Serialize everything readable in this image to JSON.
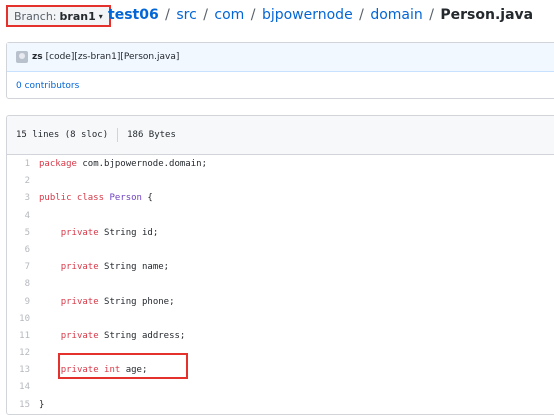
{
  "header": {
    "branch_label": "Branch:",
    "branch_value": "bran1",
    "caret": "▾",
    "crumbs": [
      {
        "text": "test06"
      },
      {
        "text": "src"
      },
      {
        "text": "com"
      },
      {
        "text": "bjpowernode"
      },
      {
        "text": "domain"
      }
    ],
    "separator": "/",
    "file_name": "Person.java"
  },
  "commit": {
    "author": "zs",
    "message": "[code][zs-bran1][Person.java]",
    "contributors": "0 contributors"
  },
  "file": {
    "lines_info": "15 lines (8 sloc)",
    "size": "186 Bytes",
    "code_lines": [
      {
        "n": "1",
        "parts": [
          [
            "kw",
            "package "
          ],
          [
            "plain",
            "com.bjpowernode.domain;"
          ]
        ]
      },
      {
        "n": "2",
        "parts": []
      },
      {
        "n": "3",
        "parts": [
          [
            "kw",
            "public class "
          ],
          [
            "cls",
            "Person"
          ],
          [
            "plain",
            " {"
          ]
        ]
      },
      {
        "n": "4",
        "parts": []
      },
      {
        "n": "5",
        "parts": [
          [
            "plain",
            "    "
          ],
          [
            "kw",
            "private "
          ],
          [
            "plain",
            "String id;"
          ]
        ]
      },
      {
        "n": "6",
        "parts": []
      },
      {
        "n": "7",
        "parts": [
          [
            "plain",
            "    "
          ],
          [
            "kw",
            "private "
          ],
          [
            "plain",
            "String name;"
          ]
        ]
      },
      {
        "n": "8",
        "parts": []
      },
      {
        "n": "9",
        "parts": [
          [
            "plain",
            "    "
          ],
          [
            "kw",
            "private "
          ],
          [
            "plain",
            "String phone;"
          ]
        ]
      },
      {
        "n": "10",
        "parts": []
      },
      {
        "n": "11",
        "parts": [
          [
            "plain",
            "    "
          ],
          [
            "kw",
            "private "
          ],
          [
            "plain",
            "String address;"
          ]
        ]
      },
      {
        "n": "12",
        "parts": []
      },
      {
        "n": "13",
        "parts": [
          [
            "plain",
            "    "
          ],
          [
            "kw",
            "private int "
          ],
          [
            "plain",
            "age;"
          ]
        ]
      },
      {
        "n": "14",
        "parts": []
      },
      {
        "n": "15",
        "parts": [
          [
            "plain",
            "}"
          ]
        ]
      }
    ]
  },
  "colors": {
    "annotation_red": "#e5312c",
    "link_blue": "#0366d6",
    "keyword_red": "#d73a49",
    "class_purple": "#6f42c1"
  }
}
